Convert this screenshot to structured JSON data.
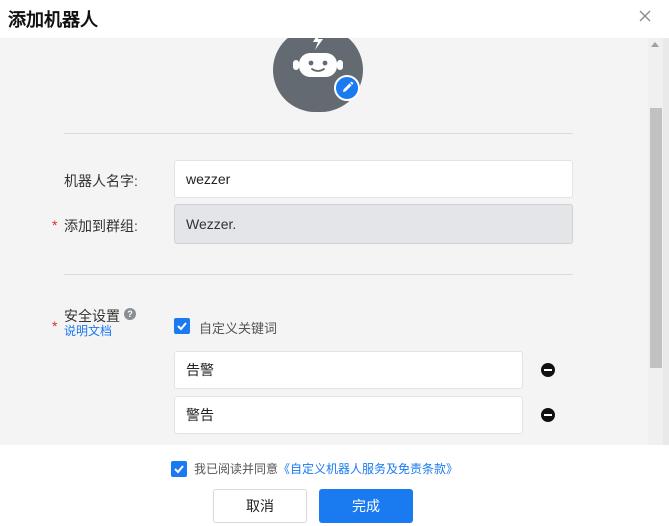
{
  "dialog": {
    "title": "添加机器人",
    "close_icon": "close-icon"
  },
  "avatar": {
    "icon": "robot-icon",
    "edit_icon": "pencil-icon",
    "accent": "#1a7af0"
  },
  "form": {
    "name_label": "机器人名字:",
    "name_value": "wezzer",
    "group_label": "添加到群组:",
    "group_value": "Wezzer.",
    "required_mark": "*",
    "security_label": "安全设置",
    "security_help_icon": "question-circle-icon",
    "doc_link": "说明文档",
    "custom_keyword_label": "自定义关键词",
    "custom_keyword_checked": true,
    "keywords": [
      "告警",
      "警告"
    ],
    "remove_icon": "minus-circle-icon"
  },
  "footer": {
    "agree_checked": true,
    "agree_text": "我已阅读并同意",
    "agree_link": "《自定义机器人服务及免责条款》",
    "cancel_label": "取消",
    "confirm_label": "完成"
  }
}
